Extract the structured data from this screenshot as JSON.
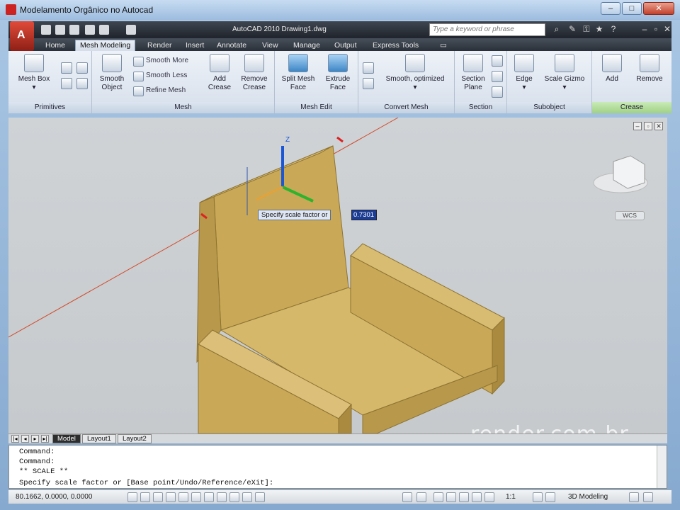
{
  "window": {
    "title": "Modelamento Orgânico no Autocad"
  },
  "app": {
    "title": "AutoCAD 2010    Drawing1.dwg",
    "logo": "A",
    "search_placeholder": "Type a keyword or phrase"
  },
  "tabs": [
    "Home",
    "Mesh Modeling",
    "Render",
    "Insert",
    "Annotate",
    "View",
    "Manage",
    "Output",
    "Express Tools"
  ],
  "ribbon": {
    "primitives": {
      "name": "Primitives",
      "mesh_box": "Mesh Box"
    },
    "mesh": {
      "name": "Mesh",
      "smooth_object": "Smooth Object",
      "smooth_more": "Smooth More",
      "smooth_less": "Smooth Less",
      "refine_mesh": "Refine Mesh",
      "add_crease": "Add Crease",
      "remove_crease": "Remove Crease"
    },
    "mesh_edit": {
      "name": "Mesh Edit",
      "split_face": "Split Mesh Face",
      "extrude_face": "Extrude Face"
    },
    "convert_mesh": {
      "name": "Convert Mesh",
      "smooth_optimized": "Smooth, optimized"
    },
    "section": {
      "name": "Section",
      "section_plane": "Section Plane"
    },
    "subobject": {
      "name": "Subobject",
      "edge": "Edge",
      "scale_gizmo": "Scale Gizmo"
    },
    "crease": {
      "name": "Crease",
      "add": "Add",
      "remove": "Remove"
    }
  },
  "viewport": {
    "prompt": "Specify scale factor or",
    "value": "0.7301",
    "wcs": "WCS",
    "watermark": "render.com.br",
    "axis_z": "Z",
    "colors": {
      "model": "#c9a957",
      "model_dark": "#a98a3e",
      "line": "#d24a2a"
    }
  },
  "layout_tabs": [
    "Model",
    "Layout1",
    "Layout2"
  ],
  "command": {
    "lines": [
      "Command:",
      "Command:",
      "** SCALE **",
      "Specify scale factor or [Base point/Undo/Reference/eXit]:"
    ]
  },
  "status": {
    "coords": "80.1662, 0.0000, 0.0000",
    "scale": "1:1",
    "workspace": "3D Modeling"
  }
}
